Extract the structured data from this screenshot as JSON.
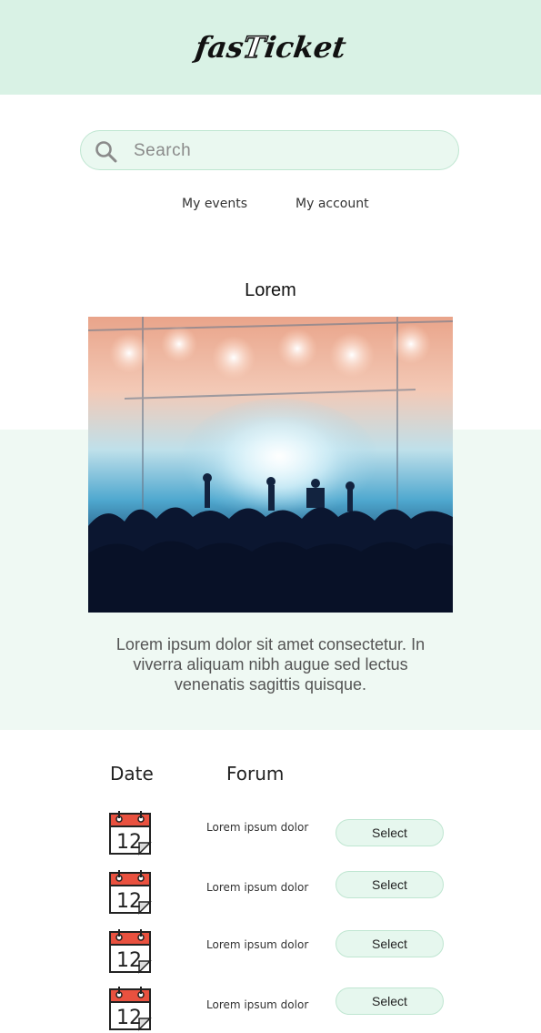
{
  "header": {
    "logo_part1": "fas",
    "logo_part2": "T",
    "logo_part3": "icket"
  },
  "search": {
    "placeholder": "Search",
    "icon": "search-icon"
  },
  "nav": {
    "events_label": "My events",
    "account_label": "My account"
  },
  "event": {
    "title": "Lorem",
    "description": "Lorem ipsum dolor sit amet consectetur. In viverra aliquam nibh augue sed lectus venenatis sagittis quisque."
  },
  "table": {
    "date_header": "Date",
    "forum_header": "Forum",
    "rows": [
      {
        "day": "12",
        "text": "Lorem ipsum dolor",
        "button": "Select"
      },
      {
        "day": "12",
        "text": "Lorem ipsum dolor",
        "button": "Select"
      },
      {
        "day": "12",
        "text": "Lorem ipsum dolor",
        "button": "Select"
      },
      {
        "day": "12",
        "text": "Lorem ipsum dolor",
        "button": "Select"
      }
    ]
  },
  "colors": {
    "header_bg": "#d9f2e5",
    "band_bg": "#eff9f3",
    "button_bg": "#e6f7ee",
    "calendar_red": "#e9513f"
  }
}
